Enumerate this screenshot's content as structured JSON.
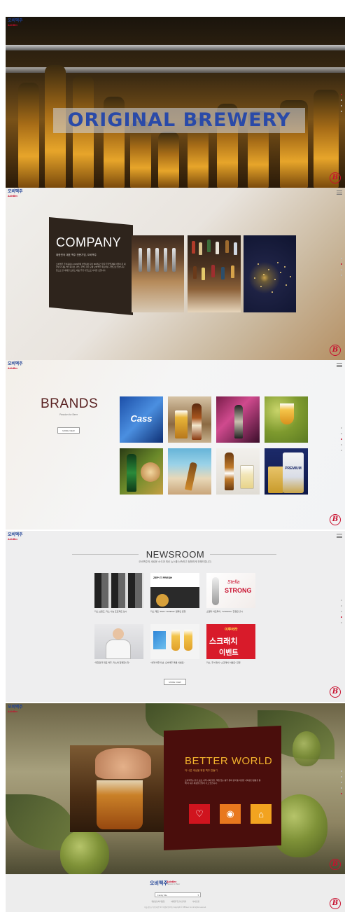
{
  "header": {
    "logo_korean": "오비맥주",
    "logo_english": "AbInBev"
  },
  "hero": {
    "title": "ORIGINAL BREWERY"
  },
  "company": {
    "title": "COMPANY",
    "subtitle": "대한민국 대표 맥주 전문기업, 오비맥주",
    "description": "오비맥주 주식회사는 1933년에 설립되어 지난 80여년간 한국 주류업계를 이끌어 온 대한민국 대표 맥주회사로, 카스, 한맥, 골든 오황 오비맥주 제조하는 기업으로 있습니다. 앞으로 전 세계인 브랜드 대표 주류 기업으로 나아갈 것입니다.",
    "more_label": "MORE VIEW"
  },
  "brands": {
    "title": "BRANDS",
    "subtitle": "Passion for Beer",
    "more_label": "MORE VIEW",
    "tiles": [
      {
        "name": "cass",
        "label": "Cass"
      },
      {
        "name": "budweiser-glass",
        "label": ""
      },
      {
        "name": "hanmac-party",
        "label": ""
      },
      {
        "name": "hop-glass",
        "label": ""
      },
      {
        "name": "green-bottle",
        "label": ""
      },
      {
        "name": "beach-bottle",
        "label": ""
      },
      {
        "name": "hoegaarden",
        "label": "Hoegaarden"
      },
      {
        "name": "premium",
        "label": "PREMIUM"
      }
    ]
  },
  "newsroom": {
    "title": "NEWSROOM",
    "subtitle": "오비맥주의 새로운 소식과 최신 뉴스를 신속하고 정확하게 전해드립니다.",
    "more_label": "MORE VIEW",
    "cards": [
      {
        "caption": "카스 브랜드, 카스 나눔 프로젝트 실시"
      },
      {
        "caption": "카스 제로 \"ZEP IT FRESH\" 캠페인 론칭"
      },
      {
        "caption": "스텔라 아르투아, \"STRONG\" 한정판 출시"
      },
      {
        "caption": "\"대한민국 대표 맥주, 카스와 함께합니다\""
      },
      {
        "caption": "\"세계 맥주의 날, 오비맥주 특별 이벤트\""
      },
      {
        "caption": "카스, 추석 맞이 \"스크래치 이벤트\" 진행"
      }
    ],
    "card_images": {
      "zep_text": "ZEP IT FRESH",
      "strong_script": "Stella",
      "strong_text": "STRONG",
      "event_top": "이루어라",
      "event_main": "스크래치",
      "event_bottom": "이벤트"
    }
  },
  "better_world": {
    "title": "BETTER WORLD",
    "subtitle": "더 나은 세상을 위한 맥주 만들기",
    "description": "오비맥주는 환경 보호, 지역 사회 발전, 책임 있는 음주 문화 정착 등 다양한 사회공헌 활동을 통해 더 나은 세상을 만들어 가고 있습니다.",
    "icons": [
      "heart-hands-icon",
      "drop-icon",
      "building-icon"
    ]
  },
  "footer": {
    "logo_korean": "오비맥주",
    "logo_english": "AbInBev",
    "tagline": "Passion for Beer",
    "family_site": "Family Site",
    "links": [
      "개인정보처리방침",
      "이메일 무단수집거부",
      "사이트맵"
    ],
    "copyright": "서울 강남구 영동대로 517 아셈타워 15층  Copyright © OB Beer Co. All rights reserved."
  },
  "colors": {
    "brand_blue": "#1c3f94",
    "brand_red": "#c8102e",
    "gold": "#f2b22d",
    "maroon": "#4a0e0c"
  }
}
